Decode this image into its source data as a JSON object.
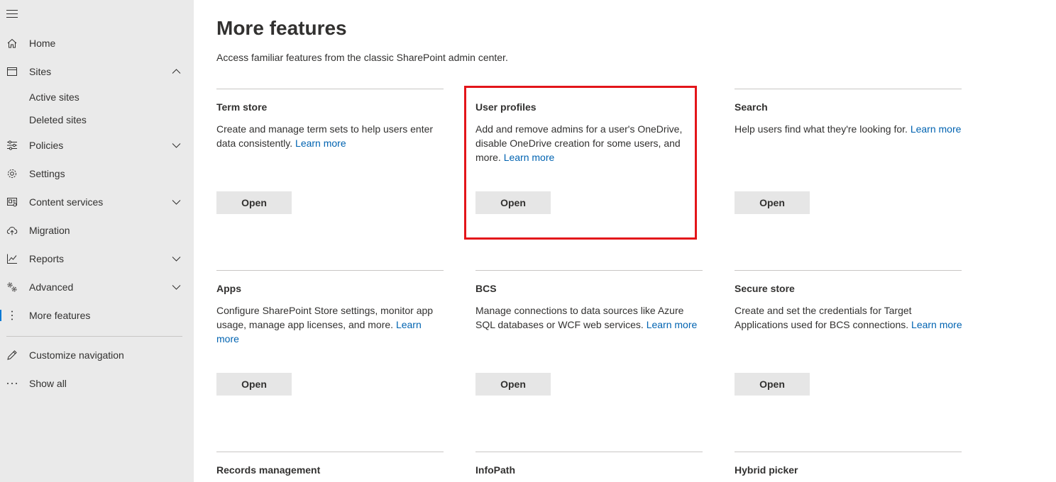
{
  "sidebar": {
    "items": [
      {
        "label": "Home"
      },
      {
        "label": "Sites"
      },
      {
        "label": "Active sites"
      },
      {
        "label": "Deleted sites"
      },
      {
        "label": "Policies"
      },
      {
        "label": "Settings"
      },
      {
        "label": "Content services"
      },
      {
        "label": "Migration"
      },
      {
        "label": "Reports"
      },
      {
        "label": "Advanced"
      },
      {
        "label": "More features"
      },
      {
        "label": "Customize navigation"
      },
      {
        "label": "Show all"
      }
    ]
  },
  "main": {
    "title": "More features",
    "description": "Access familiar features from the classic SharePoint admin center.",
    "open_label": "Open",
    "learn_more": "Learn more",
    "cards": [
      {
        "title": "Term store",
        "description": "Create and manage term sets to help users enter data consistently."
      },
      {
        "title": "User profiles",
        "description": "Add and remove admins for a user's OneDrive, disable OneDrive creation for some users, and more."
      },
      {
        "title": "Search",
        "description": "Help users find what they're looking for."
      },
      {
        "title": "Apps",
        "description": "Configure SharePoint Store settings, monitor app usage, manage app licenses, and more."
      },
      {
        "title": "BCS",
        "description": "Manage connections to data sources like Azure SQL databases or WCF web services."
      },
      {
        "title": "Secure store",
        "description": "Create and set the credentials for Target Applications used for BCS connections."
      },
      {
        "title": "Records management",
        "description": ""
      },
      {
        "title": "InfoPath",
        "description": ""
      },
      {
        "title": "Hybrid picker",
        "description": ""
      }
    ]
  },
  "colors": {
    "accent": "#0078d4",
    "link": "#0063b1",
    "highlight": "#e3151a",
    "sidebar_bg": "#eaeaea"
  }
}
